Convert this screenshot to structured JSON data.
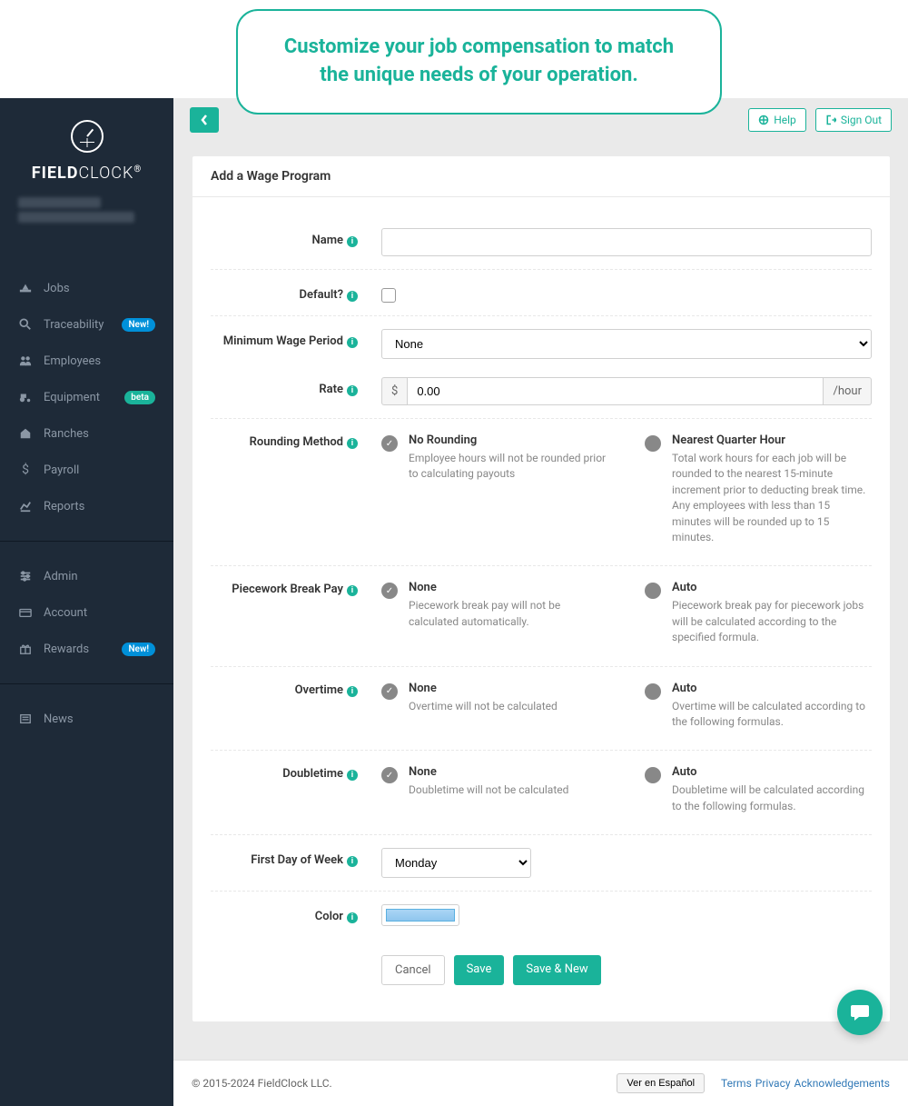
{
  "banner": {
    "text": "Customize your job compensation to match the unique needs of your operation."
  },
  "brand": {
    "name_bold": "FIELD",
    "name_light": "CLOCK"
  },
  "sidebar": {
    "items": [
      {
        "label": "Jobs"
      },
      {
        "label": "Traceability",
        "badge": "New!"
      },
      {
        "label": "Employees"
      },
      {
        "label": "Equipment",
        "badge": "beta"
      },
      {
        "label": "Ranches"
      },
      {
        "label": "Payroll"
      },
      {
        "label": "Reports"
      }
    ],
    "lower": [
      {
        "label": "Admin"
      },
      {
        "label": "Account"
      },
      {
        "label": "Rewards",
        "badge": "New!"
      }
    ],
    "news": {
      "label": "News"
    }
  },
  "topbar": {
    "help": "Help",
    "signout": "Sign Out"
  },
  "form": {
    "title": "Add a Wage Program",
    "labels": {
      "name": "Name",
      "default": "Default?",
      "mwp": "Minimum Wage Period",
      "rate": "Rate",
      "rounding": "Rounding Method",
      "piecework": "Piecework Break Pay",
      "overtime": "Overtime",
      "doubletime": "Doubletime",
      "first_day": "First Day of Week",
      "color": "Color"
    },
    "mwp_value": "None",
    "rate_currency": "$",
    "rate_value": "0.00",
    "rate_unit": "/hour",
    "rounding": {
      "opt1_title": "No Rounding",
      "opt1_desc": "Employee hours will not be rounded prior to calculating payouts",
      "opt2_title": "Nearest Quarter Hour",
      "opt2_desc": "Total work hours for each job will be rounded to the nearest 15-minute increment prior to deducting break time. Any employees with less than 15 minutes will be rounded up to 15 minutes."
    },
    "piecework": {
      "opt1_title": "None",
      "opt1_desc": "Piecework break pay will not be calculated automatically.",
      "opt2_title": "Auto",
      "opt2_desc": "Piecework break pay for piecework jobs will be calculated according to the specified formula."
    },
    "overtime": {
      "opt1_title": "None",
      "opt1_desc": "Overtime will not be calculated",
      "opt2_title": "Auto",
      "opt2_desc": "Overtime will be calculated according to the following formulas."
    },
    "doubletime": {
      "opt1_title": "None",
      "opt1_desc": "Doubletime will not be calculated",
      "opt2_title": "Auto",
      "opt2_desc": "Doubletime will be calculated according to the following formulas."
    },
    "first_day_value": "Monday",
    "buttons": {
      "cancel": "Cancel",
      "save": "Save",
      "save_new": "Save & New"
    }
  },
  "footer": {
    "copyright": "© 2015-2024 FieldClock LLC.",
    "lang": "Ver en Español",
    "links": {
      "terms": "Terms",
      "privacy": "Privacy",
      "ack": "Acknowledgements"
    }
  }
}
